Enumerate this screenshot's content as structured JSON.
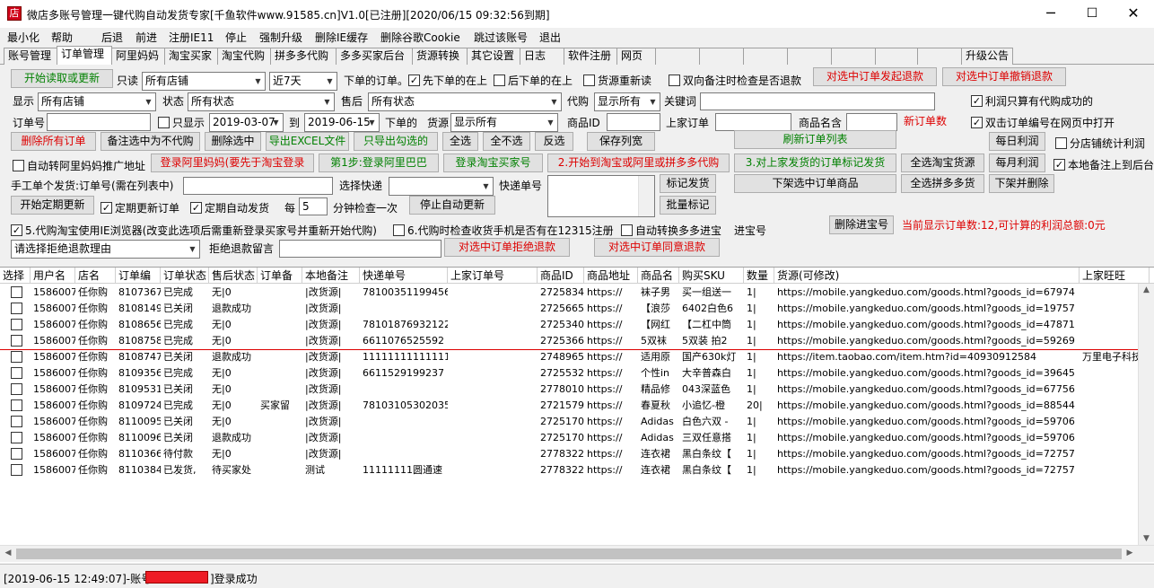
{
  "window": {
    "title": "微店多账号管理一键代购自动发货专家[千鱼软件www.91585.cn]V1.0[已注册][2020/06/15 09:32:56到期]",
    "minimize_glyph": "─",
    "maximize_glyph": "☐",
    "close_glyph": "✕"
  },
  "menu": [
    "最小化",
    "帮助",
    "后退",
    "前进",
    "注册IE11",
    "停止",
    "强制升级",
    "删除IE缓存",
    "删除谷歌Cookie",
    "跳过该账号",
    "退出"
  ],
  "tabs": [
    "账号管理",
    "订单管理",
    "阿里妈妈",
    "淘宝买家",
    "淘宝代购",
    "拼多多代购",
    "多多买家后台",
    "货源转换",
    "其它设置",
    "日志",
    "软件注册",
    "网页",
    "升级公告"
  ],
  "filters": {
    "read_btn": "开始读取或更新",
    "readonly_label": "只读",
    "shop_select": "所有店铺",
    "days_select": "近7天",
    "own_orders_label": "下单的订单。",
    "first_above": "先下单的在上",
    "last_above": "后下单的在上",
    "refetch_source": "货源重新读",
    "dual_remark": "双向备注时检查是否退款",
    "refund_btn": "对选中订单发起退款",
    "cancel_refund_btn": "对选中订单撤销退款",
    "display_label": "显示",
    "display_select": "所有店铺",
    "status_label": "状态",
    "status_select": "所有状态",
    "after_sale_label": "售后",
    "after_sale_select": "所有状态",
    "agent_label": "代购",
    "agent_select": "显示所有",
    "keyword_label": "关键词",
    "keyword_value": "",
    "profit_only_success": "利润只算有代购成功的",
    "order_no_label": "订单号",
    "only_show_label": "只显示",
    "date_from": "2019-03-07",
    "to_label": "到",
    "date_to": "2019-06-15",
    "ordered_label": "下单的",
    "source_label": "货源",
    "source_select": "显示所有",
    "product_id_label": "商品ID",
    "upstream_order_label": "上家订单",
    "product_alias_label": "商品名含",
    "new_orders_label": "新订单数",
    "dblclick_open": "双击订单编号在网页中打开"
  },
  "actions": {
    "delete_all": "删除所有订单",
    "remark_not_agent": "备注选中为不代购",
    "delete_selected": "删除选中",
    "export_excel": "导出EXCEL文件",
    "export_checked": "只导出勾选的",
    "select_all": "全选",
    "select_none": "全不选",
    "invert": "反选",
    "save_view": "保存列宽",
    "refresh_list": "刷新订单列表",
    "daily_profit": "每日利润",
    "per_shop_stats": "分店铺统计利润",
    "auto_ali_promo": "自动转阿里妈妈推广地址",
    "login_ali": "登录阿里妈妈(要先于淘宝登录",
    "step1_login_1688": "第1步:登录阿里巴巴",
    "login_taobao_buyer": "登录淘宝买家号",
    "step2_agent": "2.开始到淘宝或阿里或拼多多代购",
    "step3_mark": "3.对上家发货的订单标记发货",
    "select_all_taobao": "全选淘宝货源",
    "monthly_profit": "每月利润",
    "local_remark_upload": "本地备注上到后台",
    "manual_ship_label": "手工单个发货:订单号(需在列表中)",
    "choose_express_label": "选择快递",
    "express_no_label": "快递单号",
    "mark_ship": "标记发货",
    "batch_mark": "批量标记",
    "delist_selected": "下架选中订单商品",
    "select_all_pdd": "全选拼多多货",
    "delist_delete": "下架并删除",
    "start_periodic_update": "开始定期更新",
    "periodic_update_orders": "定期更新订单",
    "periodic_auto_ship": "定期自动发货",
    "every_label": "每",
    "minutes_value": "5",
    "minutes_label": "分钟检查一次",
    "stop_auto_update": "停止自动更新",
    "delete_jinbao": "删除进宝号",
    "summary": "当前显示订单数:12,可计算的利润总额:0元",
    "taobao_ie_opt": "5.代购淘宝使用IE浏览器(改变此选项后需重新登录买家号并重新开始代购)",
    "check_phone_opt": "6.代购时检查收货手机是否有在12315注册",
    "auto_convert_pdd": "自动转换多多进宝",
    "jinbao_label": "进宝号",
    "reject_reason_select": "请选择拒绝退款理由",
    "reject_msg_label": "拒绝退款留言",
    "reject_refund_btn": "对选中订单拒绝退款",
    "agree_refund_btn": "对选中订单同意退款"
  },
  "grid": {
    "columns": [
      "选择",
      "用户名",
      "店名",
      "订单编",
      "订单状态",
      "售后状态",
      "订单备",
      "本地备注",
      "快递单号",
      "上家订单号",
      "商品ID",
      "商品地址",
      "商品名",
      "购买SKU",
      "数量",
      "货源(可修改)",
      "上家旺旺"
    ],
    "rows": [
      [
        "1586007",
        "任你购",
        "8107367",
        "已完成",
        "无|0",
        "",
        "|改货源|",
        "78100351199456",
        "",
        "2725834",
        "https://",
        "袜子男",
        "买一组送一",
        "1|",
        "https://mobile.yangkeduo.com/goods.html?goods_id=67974",
        ""
      ],
      [
        "1586007",
        "任你购",
        "8108149",
        "已关闭",
        "退款成功",
        "",
        "|改货源|",
        "",
        "",
        "2725665",
        "https://",
        "【浪莎",
        "6402白色6",
        "1|",
        "https://mobile.yangkeduo.com/goods.html?goods_id=19757",
        ""
      ],
      [
        "1586007",
        "任你购",
        "8108656",
        "已完成",
        "无|0",
        "",
        "|改货源|",
        "78101876932122",
        "",
        "2725340",
        "https://",
        "【网红",
        "【二杠中筒",
        "1|",
        "https://mobile.yangkeduo.com/goods.html?goods_id=47871",
        ""
      ],
      [
        "1586007",
        "任你购",
        "8108758",
        "已完成",
        "无|0",
        "",
        "|改货源|",
        "6611076525592",
        "",
        "2725366",
        "https://",
        "5双袜",
        "5双装  拍2",
        "1|",
        "https://mobile.yangkeduo.com/goods.html?goods_id=59269",
        ""
      ],
      [
        "1586007",
        "任你购",
        "8108747",
        "已关闭",
        "退款成功",
        "",
        "|改货源|",
        "11111111111111",
        "",
        "2748965",
        "https://",
        "适用原",
        "国产630k灯",
        "1|",
        "https://item.taobao.com/item.htm?id=40930912584",
        "万里电子科技"
      ],
      [
        "1586007",
        "任你购",
        "8109356",
        "已完成",
        "无|0",
        "",
        "|改货源|",
        "6611529199237",
        "",
        "2725532",
        "https://",
        "个性in",
        "大辛普森白",
        "1|",
        "https://mobile.yangkeduo.com/goods.html?goods_id=39645",
        ""
      ],
      [
        "1586007",
        "任你购",
        "8109531",
        "已关闭",
        "无|0",
        "",
        "|改货源|",
        "",
        "",
        "2778010",
        "https://",
        "精品修",
        "043深蓝色",
        "1|",
        "https://mobile.yangkeduo.com/goods.html?goods_id=67756",
        ""
      ],
      [
        "1586007",
        "任你购",
        "8109724",
        "已完成",
        "无|0",
        "买家留",
        "|改货源|",
        "78103105302035",
        "",
        "2721579",
        "https://",
        "春夏秋",
        "小追忆-橙",
        "20|",
        "https://mobile.yangkeduo.com/goods.html?goods_id=88544",
        ""
      ],
      [
        "1586007",
        "任你购",
        "8110095",
        "已关闭",
        "无|0",
        "",
        "|改货源|",
        "",
        "",
        "2725170",
        "https://",
        "Adidas",
        "白色六双 -",
        "1|",
        "https://mobile.yangkeduo.com/goods.html?goods_id=59706",
        ""
      ],
      [
        "1586007",
        "任你购",
        "8110096",
        "已关闭",
        "退款成功",
        "",
        "|改货源|",
        "",
        "",
        "2725170",
        "https://",
        "Adidas",
        "三双任意搭",
        "1|",
        "https://mobile.yangkeduo.com/goods.html?goods_id=59706",
        ""
      ],
      [
        "1586007",
        "任你购",
        "8110366",
        "待付款",
        "无|0",
        "",
        "|改货源|",
        "",
        "",
        "2778322",
        "https://",
        "连衣裙",
        "黑白条纹【",
        "1|",
        "https://mobile.yangkeduo.com/goods.html?goods_id=72757",
        ""
      ],
      [
        "1586007",
        "任你购",
        "8110384",
        "已发货,",
        "待买家处",
        "",
        "测试",
        "11111111圆通速",
        "",
        "2778322",
        "https://",
        "连衣裙",
        "黑白条纹【",
        "1|",
        "https://mobile.yangkeduo.com/goods.html?goods_id=72757",
        ""
      ]
    ]
  },
  "status": {
    "prefix": "[2019-06-15 12:49:07]-账号",
    "suffix": "]登录成功"
  }
}
